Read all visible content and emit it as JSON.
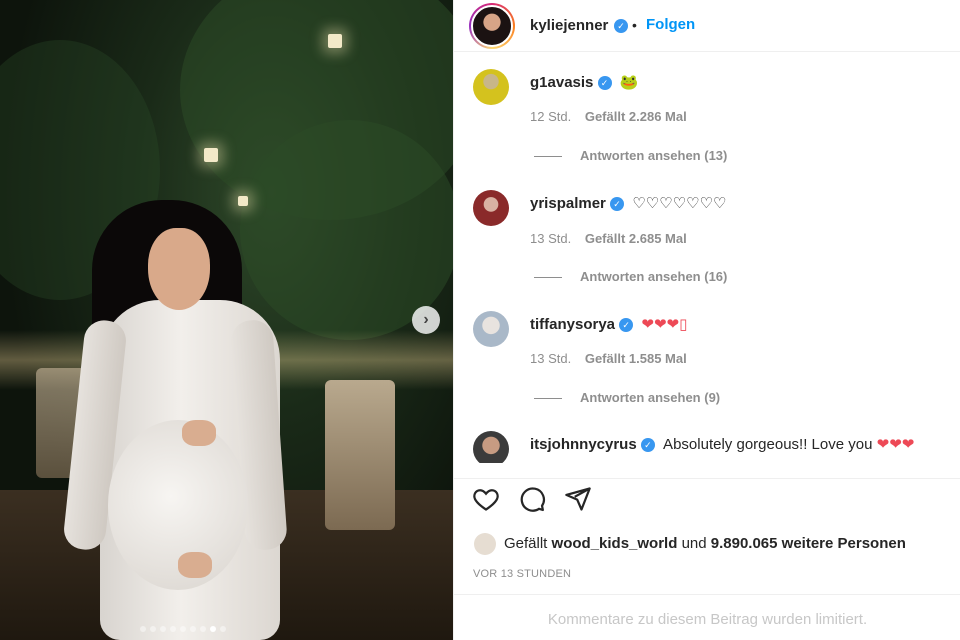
{
  "header": {
    "username": "kyliejenner",
    "separator": "•",
    "follow_label": "Folgen"
  },
  "photo": {
    "carousel_dots_total": 9,
    "carousel_dot_active": 8
  },
  "comments": [
    {
      "user": "g1avasis",
      "text": "🐸",
      "time": "12 Std.",
      "likes": "Gefällt 2.286 Mal",
      "replies": "Antworten ansehen (13)"
    },
    {
      "user": "yrispalmer",
      "text": "♡♡♡♡♡♡♡",
      "time": "13 Std.",
      "likes": "Gefällt 2.685 Mal",
      "replies": "Antworten ansehen (16)"
    },
    {
      "user": "tiffanysorya",
      "text": "❤❤❤▯",
      "time": "13 Std.",
      "likes": "Gefällt 1.585 Mal",
      "replies": "Antworten ansehen (9)"
    },
    {
      "user": "itsjohnnycyrus",
      "text": "Absolutely gorgeous!! Love you ❤❤❤"
    }
  ],
  "likes": {
    "prefix": "Gefällt",
    "user": "wood_kids_world",
    "middle": "und",
    "count_text": "9.890.065 weitere Personen"
  },
  "timestamp": "VOR 13 STUNDEN",
  "comments_limited": "Kommentare zu diesem Beitrag wurden limitiert.",
  "colors": {
    "accent": "#0095f6",
    "verified": "#3897f0",
    "heart": "#ed4956"
  }
}
